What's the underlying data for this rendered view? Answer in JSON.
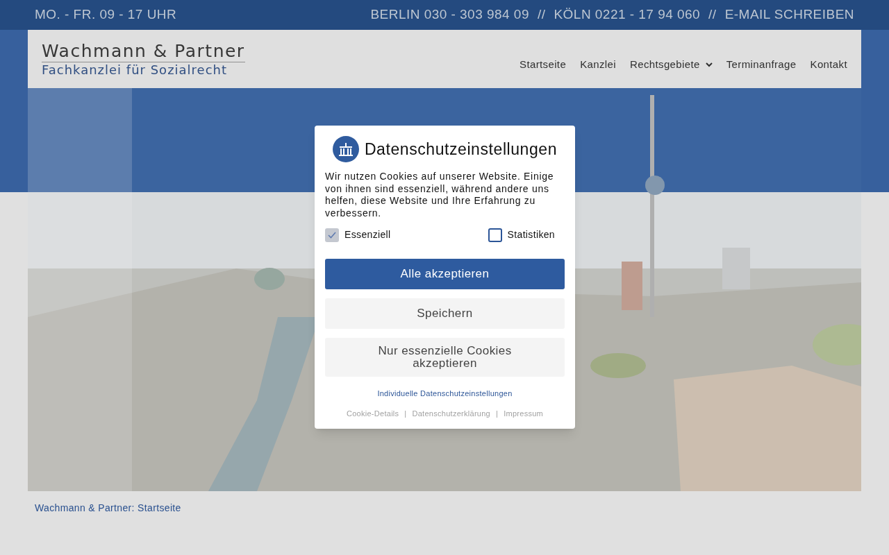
{
  "top_bar": {
    "hours": "MO. - FR. 09 - 17 UHR",
    "contacts": [
      {
        "label": "BERLIN 030 - 303 984 09"
      },
      {
        "label": "KÖLN 0221 - 17 94 060"
      },
      {
        "label": "E-MAIL SCHREIBEN"
      }
    ],
    "separator": "//"
  },
  "logo": {
    "name": "Wachmann & Partner",
    "tagline": "Fachkanzlei für Sozialrecht"
  },
  "nav": [
    {
      "label": "Startseite",
      "dropdown": false
    },
    {
      "label": "Kanzlei",
      "dropdown": false
    },
    {
      "label": "Rechtsgebiete",
      "dropdown": true
    },
    {
      "label": "Terminanfrage",
      "dropdown": false
    },
    {
      "label": "Kontakt",
      "dropdown": false
    }
  ],
  "breadcrumb": "Wachmann & Partner: Startseite",
  "cookie_dialog": {
    "title": "Datenschutzeinstellungen",
    "text": "Wir nutzen Cookies auf unserer Website. Einige von ihnen sind essenziell, während andere uns helfen, diese Website und Ihre Erfahrung zu verbessern.",
    "options": [
      {
        "label": "Essenziell",
        "checked": true,
        "disabled": true
      },
      {
        "label": "Statistiken",
        "checked": false,
        "disabled": false
      }
    ],
    "buttons": [
      {
        "label": "Alle akzeptieren",
        "kind": "primary"
      },
      {
        "label": "Speichern",
        "kind": "secondary"
      },
      {
        "label": "Nur essenzielle Cookies akzeptieren",
        "kind": "secondary"
      }
    ],
    "settings_link": "Individuelle Datenschutzeinstellungen",
    "footer_links": [
      {
        "label": "Cookie-Details"
      },
      {
        "label": "Datenschutzerklärung"
      },
      {
        "label": "Impressum"
      }
    ],
    "footer_separator": "|"
  }
}
